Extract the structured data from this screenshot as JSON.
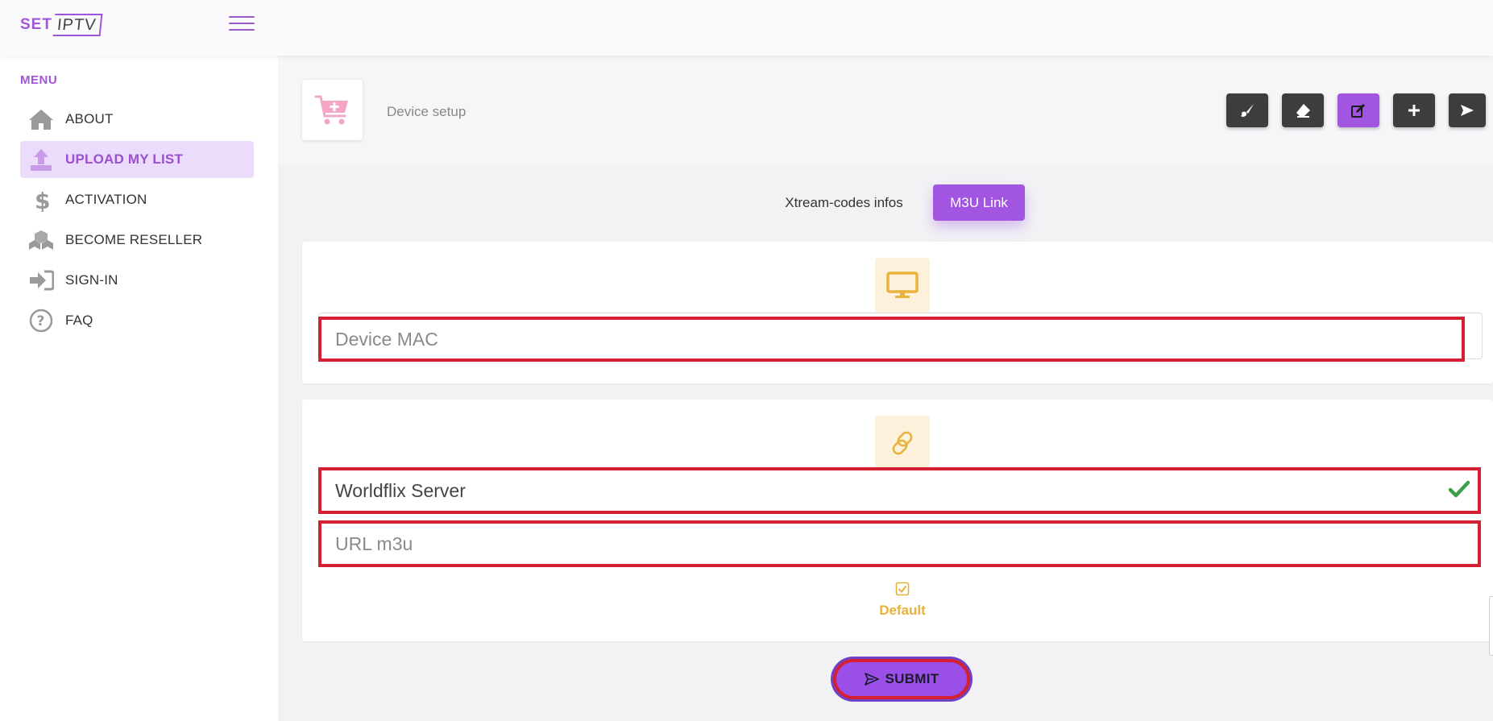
{
  "brand": {
    "set": "SET",
    "iptv": "IPTV"
  },
  "sidebar": {
    "title": "MENU",
    "items": [
      {
        "label": "ABOUT",
        "icon": "home-icon"
      },
      {
        "label": "UPLOAD MY LIST",
        "icon": "upload-icon"
      },
      {
        "label": "ACTIVATION",
        "icon": "dollar-icon"
      },
      {
        "label": "BECOME RESELLER",
        "icon": "boxes-icon"
      },
      {
        "label": "SIGN-IN",
        "icon": "sign-in-icon"
      },
      {
        "label": "FAQ",
        "icon": "question-icon"
      }
    ],
    "active_index": 1
  },
  "header": {
    "title": "Device setup",
    "tools": [
      "brush-icon",
      "eraser-icon",
      "edit-icon",
      "plus-icon",
      "send-icon"
    ]
  },
  "tabs": [
    {
      "label": "Xtream-codes infos",
      "active": false
    },
    {
      "label": "M3U Link",
      "active": true
    }
  ],
  "form": {
    "mac": {
      "placeholder": "Device MAC",
      "value": ""
    },
    "server": {
      "placeholder": "",
      "value": "Worldflix Server",
      "valid": true
    },
    "url": {
      "placeholder": "URL m3u",
      "value": ""
    },
    "default_label": "Default",
    "default_checked": true,
    "submit_label": "SUBMIT"
  },
  "colors": {
    "accent": "#a155e0",
    "highlight_border": "#d42032",
    "badge_bg": "#fdf1dc",
    "badge_icon": "#e8b23c",
    "valid": "#3a9e4a"
  }
}
